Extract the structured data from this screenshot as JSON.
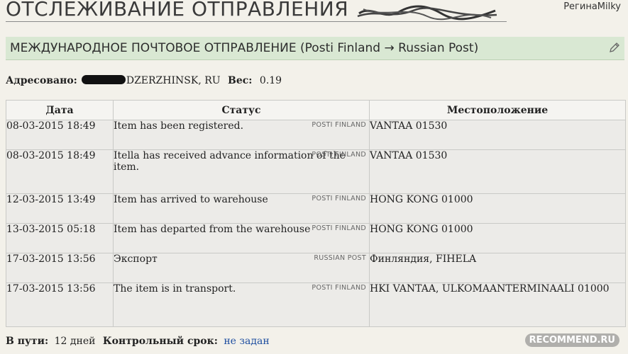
{
  "header": {
    "title": "ОТСЛЕЖИВАНИЕ ОТПРАВЛЕНИЯ",
    "user": "РегинаMilky"
  },
  "section": {
    "title": "МЕЖДУНАРОДНОЕ ПОЧТОВОЕ ОТПРАВЛЕНИЕ (Posti Finland → Russian Post)"
  },
  "meta": {
    "addressed_label": "Адресовано:",
    "addressed_value": "DZERZHINSK, RU",
    "weight_label": "Вес:",
    "weight_value": "0.19"
  },
  "table": {
    "headers": {
      "date": "Дата",
      "status": "Статус",
      "location": "Местоположение"
    },
    "rows": [
      {
        "carrier": "POSTI FINLAND",
        "date": "08-03-2015 18:49",
        "status": "Item has been registered.",
        "location": "VANTAA 01530"
      },
      {
        "carrier": "POSTI FINLAND",
        "date": "08-03-2015 18:49",
        "status": "Itella has received advance information of the item.",
        "location": "VANTAA 01530"
      },
      {
        "carrier": "POSTI FINLAND",
        "date": "12-03-2015 13:49",
        "status": "Item has arrived to warehouse",
        "location": "HONG KONG 01000"
      },
      {
        "carrier": "POSTI FINLAND",
        "date": "13-03-2015 05:18",
        "status": "Item has departed from the warehouse",
        "location": "HONG KONG 01000"
      },
      {
        "carrier": "RUSSIAN POST",
        "date": "17-03-2015 13:56",
        "status": "Экспорт",
        "location": "Финляндия, FIHELA"
      },
      {
        "carrier": "POSTI FINLAND",
        "date": "17-03-2015 13:56",
        "status": "The item is in transport.",
        "location": "HKI VANTAA, ULKOMAANTERMINAALI 01000"
      }
    ]
  },
  "footer": {
    "transit_label": "В пути:",
    "transit_value": "12 дней",
    "deadline_label": "Контрольный срок:",
    "deadline_value": "не задан"
  },
  "watermark": "RECOMMEND.RU",
  "colors": {
    "section_bg": "#d9e8d3",
    "link": "#1f4fa0"
  }
}
